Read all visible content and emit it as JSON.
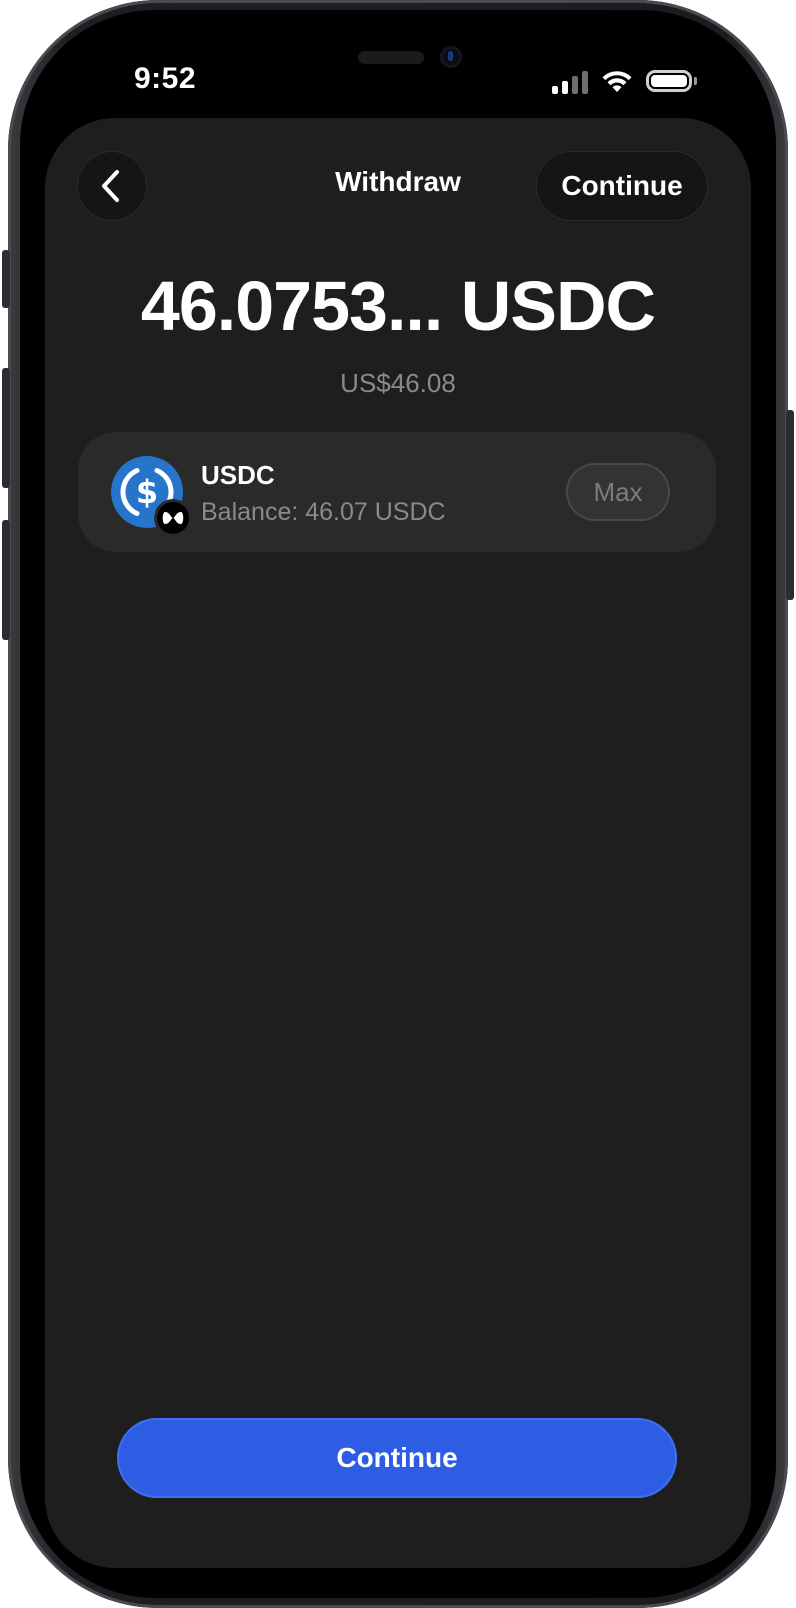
{
  "status_bar": {
    "time": "9:52",
    "icons": [
      "cellular-signal-icon",
      "wifi-icon",
      "battery-icon"
    ]
  },
  "header": {
    "back_icon": "chevron-left-icon",
    "title": "Withdraw",
    "continue_label": "Continue"
  },
  "amount": {
    "value": "46.0753... USDC",
    "fiat": "US$46.08"
  },
  "token": {
    "icon": "usdc-token-icon",
    "badge_icon": "network-badge-icon",
    "name": "USDC",
    "balance": "Balance: 46.07 USDC",
    "max_label": "Max"
  },
  "footer": {
    "continue_label": "Continue"
  },
  "colors": {
    "screen_bg": "#1e1e1f",
    "card_bg": "#2a2a2b",
    "accent": "#2d5de3",
    "usdc_blue": "#2775ca",
    "muted_text": "#8a8a8e"
  }
}
